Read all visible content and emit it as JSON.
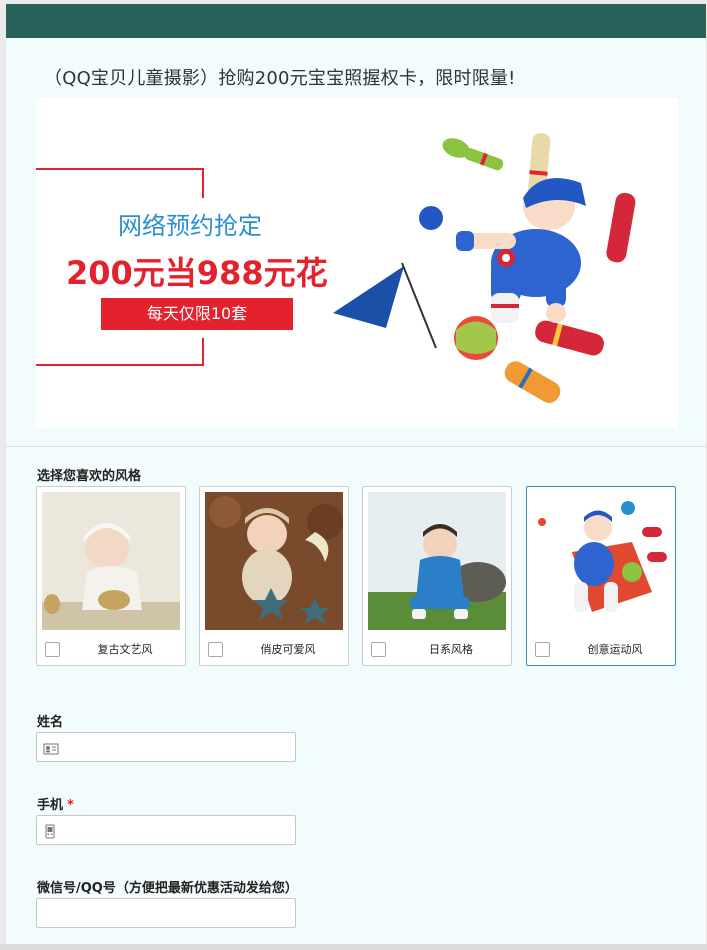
{
  "page": {
    "title": "（QQ宝贝儿童摄影）抢购200元宝宝照握权卡，限时限量!"
  },
  "banner": {
    "line1": "网络预约抢定",
    "line2": "200元当988元花",
    "line3": "每天仅限10套",
    "accent_red": "#e4222e",
    "accent_blue": "#2a8fd0"
  },
  "style_section": {
    "label": "选择您喜欢的风格",
    "options": [
      {
        "label": "复古文艺风",
        "checked": false,
        "selected": false
      },
      {
        "label": "俏皮可爱风",
        "checked": false,
        "selected": false
      },
      {
        "label": "日系风格",
        "checked": false,
        "selected": false
      },
      {
        "label": "创意运动风",
        "checked": false,
        "selected": true
      }
    ]
  },
  "form": {
    "name": {
      "label": "姓名",
      "value": "",
      "icon": "id-card-icon"
    },
    "phone": {
      "label": "手机",
      "required_mark": "*",
      "value": "",
      "icon": "mobile-phone-icon"
    },
    "wechat": {
      "label": "微信号/QQ号（方便把最新优惠活动发给您）",
      "value": ""
    }
  },
  "colors": {
    "header": "#28605a",
    "background": "#f2fcfc",
    "selected_border": "#3a8fbf"
  }
}
